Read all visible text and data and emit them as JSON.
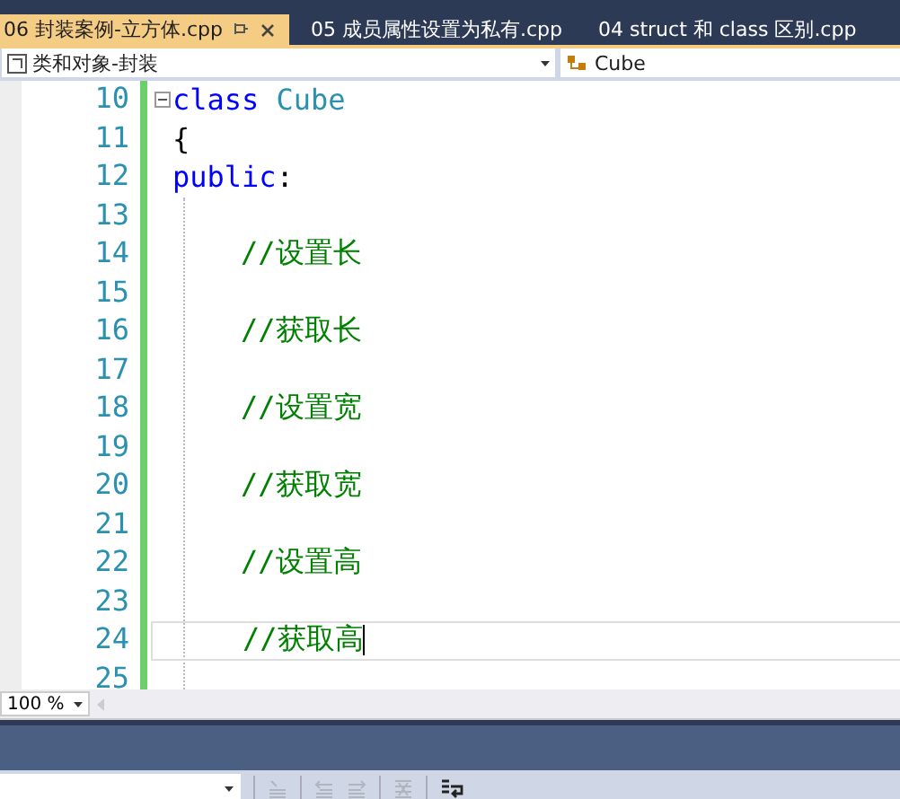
{
  "tabs": [
    {
      "label": "06 封装案例-立方体.cpp",
      "selected": true
    },
    {
      "label": "05 成员属性设置为私有.cpp",
      "selected": false
    },
    {
      "label": "04 struct 和 class 区别.cpp",
      "selected": false
    }
  ],
  "navigation_bar": {
    "scope": "类和对象-封装",
    "member": "Cube"
  },
  "editor": {
    "lines": [
      {
        "number": "10",
        "collapsible": true,
        "current": false,
        "tokens": [
          {
            "kind": "keyword",
            "text": "class"
          },
          {
            "kind": "type",
            "text": "Cube"
          }
        ]
      },
      {
        "number": "11",
        "collapsible": false,
        "current": false,
        "tokens": [
          {
            "kind": "plain",
            "text": "{"
          }
        ]
      },
      {
        "number": "12",
        "collapsible": false,
        "current": false,
        "tokens": [
          {
            "kind": "keyword",
            "text": "public"
          },
          {
            "kind": "plain",
            "text": ":"
          }
        ]
      },
      {
        "number": "13",
        "collapsible": false,
        "current": false
      },
      {
        "number": "14",
        "collapsible": false,
        "current": false,
        "tokens": [
          {
            "kind": "comment",
            "text": "//设置长"
          }
        ]
      },
      {
        "number": "15",
        "collapsible": false,
        "current": false
      },
      {
        "number": "16",
        "collapsible": false,
        "current": false,
        "tokens": [
          {
            "kind": "comment",
            "text": "//获取长"
          }
        ]
      },
      {
        "number": "17",
        "collapsible": false,
        "current": false
      },
      {
        "number": "18",
        "collapsible": false,
        "current": false,
        "tokens": [
          {
            "kind": "comment",
            "text": "//设置宽"
          }
        ]
      },
      {
        "number": "19",
        "collapsible": false,
        "current": false
      },
      {
        "number": "20",
        "collapsible": false,
        "current": false,
        "tokens": [
          {
            "kind": "comment",
            "text": "//获取宽"
          }
        ]
      },
      {
        "number": "21",
        "collapsible": false,
        "current": false
      },
      {
        "number": "22",
        "collapsible": false,
        "current": false,
        "tokens": [
          {
            "kind": "comment",
            "text": "//设置高"
          }
        ]
      },
      {
        "number": "23",
        "collapsible": false,
        "current": false
      },
      {
        "number": "24",
        "collapsible": false,
        "current": true,
        "tokens": [
          {
            "kind": "comment",
            "text": "//获取高"
          }
        ]
      },
      {
        "number": "25",
        "collapsible": false,
        "current": false
      }
    ]
  },
  "zoom": "100 %"
}
